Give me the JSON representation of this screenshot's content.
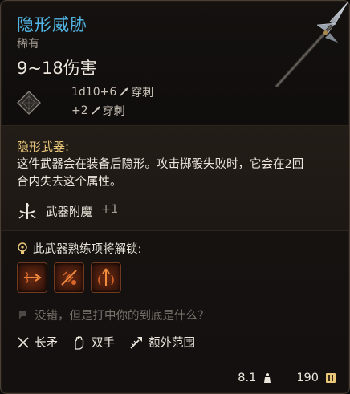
{
  "item": {
    "name": "隐形威胁",
    "rarity": "稀有",
    "damage_range": "9~18伤害",
    "damage_lines": [
      {
        "value": "1d10+6",
        "type": "穿刺"
      },
      {
        "value": "+2",
        "type": "穿刺"
      }
    ]
  },
  "property": {
    "title": "隐形武器:",
    "description": "这件武器会在装备后隐形。攻击掷骰失败时，它会在2回合内失去这个属性。",
    "enchant_label": "武器附魔",
    "enchant_bonus": "+1"
  },
  "mastery": {
    "label": "此武器熟练项将解锁:",
    "actions": [
      {
        "icon": "lunge-attack-icon"
      },
      {
        "icon": "rush-attack-icon"
      },
      {
        "icon": "piercing-strike-icon"
      }
    ]
  },
  "flavor": {
    "quote": "没错，但是打中你的到底是什么？"
  },
  "traits": [
    {
      "label": "长矛",
      "icon": "spear-icon"
    },
    {
      "label": "双手",
      "icon": "two-handed-icon"
    },
    {
      "label": "额外范围",
      "icon": "reach-icon"
    }
  ],
  "footer": {
    "weight": "8.1",
    "price": "190"
  },
  "colors": {
    "title": "#52b7e6",
    "property_title": "#e9c77a",
    "text": "#ece6dd",
    "muted": "#a39b92",
    "quote": "#77716a"
  }
}
